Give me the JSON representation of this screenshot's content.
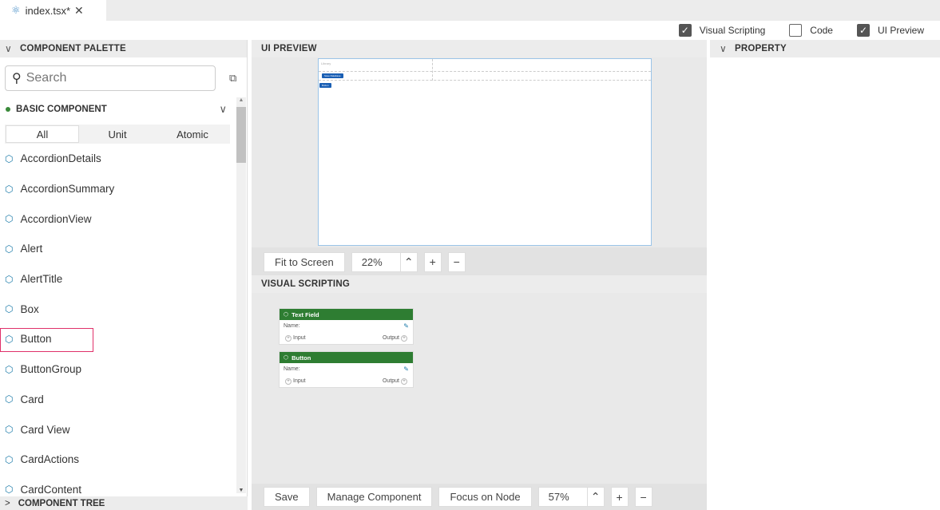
{
  "tab": {
    "icon": "react-icon",
    "label": "index.tsx*",
    "close": "✕"
  },
  "toggles": [
    {
      "label": "Visual Scripting",
      "checked": true
    },
    {
      "label": "Code",
      "checked": false
    },
    {
      "label": "UI Preview",
      "checked": true
    }
  ],
  "palette": {
    "title": "COMPONENT PALETTE",
    "search_placeholder": "Search",
    "category": "BASIC COMPONENT",
    "filters": [
      "All",
      "Unit",
      "Atomic"
    ],
    "active_filter": "All",
    "items": [
      "AccordionDetails",
      "AccordionSummary",
      "AccordionView",
      "Alert",
      "AlertTitle",
      "Box",
      "Button",
      "ButtonGroup",
      "Card",
      "Card View",
      "CardActions",
      "CardContent"
    ],
    "selected_item": "Button"
  },
  "tree": {
    "title": "COMPONENT TREE"
  },
  "preview": {
    "title": "UI PREVIEW",
    "canvas_text": "Library",
    "mini_buttons": [
      "Save Database",
      "Button"
    ],
    "toolbar": {
      "fit": "Fit to Screen",
      "zoom": "22%"
    }
  },
  "scripting": {
    "title": "VISUAL SCRIPTING",
    "nodes": [
      {
        "title": "Text Field",
        "name_label": "Name:",
        "input": "Input",
        "output": "Output"
      },
      {
        "title": "Button",
        "name_label": "Name:",
        "input": "Input",
        "output": "Output"
      }
    ],
    "toolbar": {
      "save": "Save",
      "manage": "Manage Component",
      "focus": "Focus on Node",
      "zoom": "57%"
    }
  },
  "property": {
    "title": "PROPERTY"
  }
}
